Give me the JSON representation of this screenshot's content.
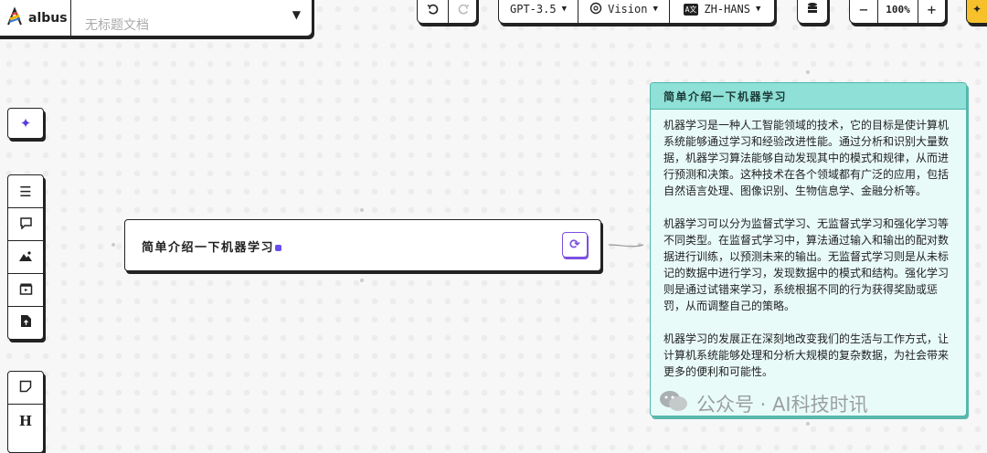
{
  "app": {
    "brand": "albus",
    "doc_title": "无标题文档"
  },
  "toolbar": {
    "undo_icon": "undo-icon",
    "redo_icon": "redo-icon",
    "model": "GPT-3.5",
    "vision": "Vision",
    "language": "ZH-HANS",
    "zoom_out": "−",
    "zoom_level": "100%",
    "zoom_in": "+"
  },
  "prompt": {
    "text": "简单介绍一下机器学习"
  },
  "response": {
    "title": "简单介绍一下机器学习",
    "paragraphs": [
      "机器学习是一种人工智能领域的技术，它的目标是使计算机系统能够通过学习和经验改进性能。通过分析和识别大量数据，机器学习算法能够自动发现其中的模式和规律，从而进行预测和决策。这种技术在各个领域都有广泛的应用，包括自然语言处理、图像识别、生物信息学、金融分析等。",
      "机器学习可以分为监督式学习、无监督式学习和强化学习等不同类型。在监督式学习中，算法通过输入和输出的配对数据进行训练，以预测未来的输出。无监督式学习则是从未标记的数据中进行学习，发现数据中的模式和结构。强化学习则是通过试错来学习，系统根据不同的行为获得奖励或惩罚，从而调整自己的策略。",
      "机器学习的发展正在深刻地改变我们的生活与工作方式，让计算机系统能够处理和分析大规模的复杂数据，为社会带来更多的便利和可能性。"
    ]
  },
  "watermark": {
    "text": "公众号 · AI科技时讯"
  },
  "colors": {
    "accent_purple": "#7b4fe0",
    "card_bg": "#e9fbf9",
    "card_header": "#8fe0d6",
    "card_border": "#4fb8ac"
  }
}
